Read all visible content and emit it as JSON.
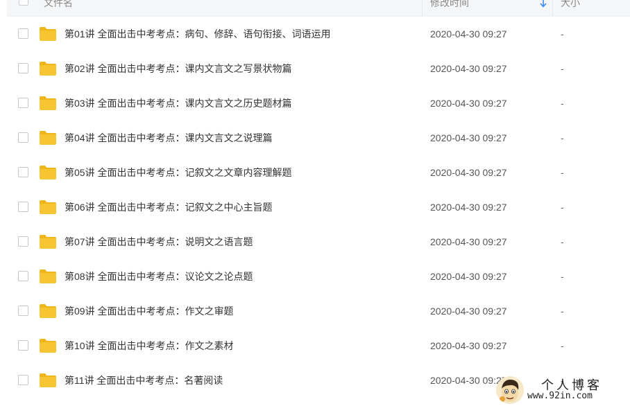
{
  "header": {
    "name_label": "文件名",
    "time_label": "修改时间",
    "size_label": "大小",
    "sort_icon": "arrow-down-icon"
  },
  "files": [
    {
      "name": "第01讲 全面出击中考考点：病句、修辞、语句衔接、词语运用",
      "time": "2020-04-30 09:27",
      "size": "-"
    },
    {
      "name": "第02讲 全面出击中考考点：课内文言文之写景状物篇",
      "time": "2020-04-30 09:27",
      "size": "-"
    },
    {
      "name": "第03讲 全面出击中考考点：课内文言文之历史题材篇",
      "time": "2020-04-30 09:27",
      "size": "-"
    },
    {
      "name": "第04讲 全面出击中考考点：课内文言文之说理篇",
      "time": "2020-04-30 09:27",
      "size": "-"
    },
    {
      "name": "第05讲 全面出击中考考点：记叙文之文章内容理解题",
      "time": "2020-04-30 09:27",
      "size": "-"
    },
    {
      "name": "第06讲 全面出击中考考点：记叙文之中心主旨题",
      "time": "2020-04-30 09:27",
      "size": "-"
    },
    {
      "name": "第07讲 全面出击中考考点：说明文之语言题",
      "time": "2020-04-30 09:27",
      "size": "-"
    },
    {
      "name": "第08讲 全面出击中考考点：议论文之论点题",
      "time": "2020-04-30 09:27",
      "size": "-"
    },
    {
      "name": "第09讲 全面出击中考考点：作文之审题",
      "time": "2020-04-30 09:27",
      "size": "-"
    },
    {
      "name": "第10讲 全面出击中考考点：作文之素材",
      "time": "2020-04-30 09:27",
      "size": "-"
    },
    {
      "name": "第11讲 全面出击中考考点：名著阅读",
      "time": "2020-04-30 09:27",
      "size": "-"
    }
  ],
  "watermark": {
    "title": "个人博客",
    "url": "www.92in.com"
  },
  "colors": {
    "folder": "#f7c531",
    "folder_tab": "#f0b619",
    "sort_arrow": "#3b8cf5"
  }
}
